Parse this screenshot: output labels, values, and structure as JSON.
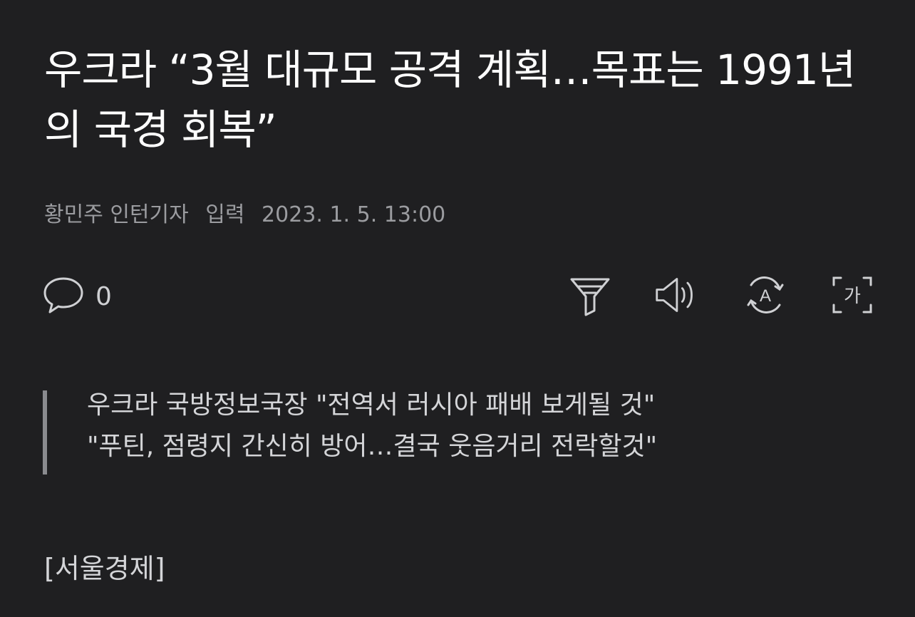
{
  "article": {
    "title": "우크라 “3월 대규모 공격 계획…목표는 1991년의 국경 회복”",
    "reporter": "황민주 인턴기자",
    "input_label": "입력",
    "timestamp": "2023. 1. 5. 13:00"
  },
  "toolbar": {
    "comment_count": "0",
    "icons": [
      "comment-icon",
      "filter-icon",
      "speaker-icon",
      "translate-icon",
      "font-size-icon"
    ],
    "font_icon_glyph": "가",
    "translate_icon_glyph": "A"
  },
  "summary": {
    "lines": [
      "우크라 국방정보국장 \"전역서 러시아 패배 보게될 것\"",
      "\"푸틴, 점령지 간신히 방어…결국 웃음거리 전락할것\""
    ]
  },
  "body": {
    "source": "[서울경제]"
  },
  "colors": {
    "background": "#1f1f21",
    "title": "#ffffff",
    "meta": "#9b9ca0",
    "icon": "#cfd0d3",
    "quote_bar": "#8a8b8f"
  }
}
